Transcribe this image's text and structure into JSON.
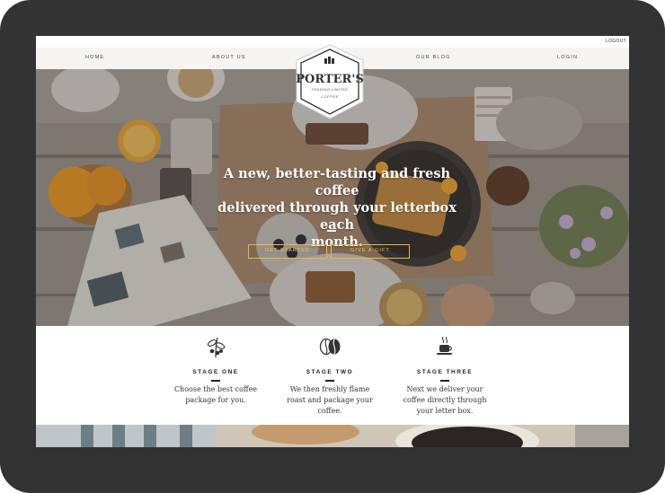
{
  "top": {
    "logout": "LOGOUT"
  },
  "nav": {
    "home": "HOME",
    "about": "ABOUT US",
    "blog": "OUR BLOG",
    "login": "LOGIN"
  },
  "logo": {
    "brand": "PORTER'S",
    "sub": "TRADING LIMITED",
    "coffee": "COFFEE"
  },
  "hero": {
    "title_line1": "A new, better-tasting and fresh coffee",
    "title_line2": "delivered through your letterbox each",
    "title_line3": "month.",
    "btn_start": "GET STARTED",
    "btn_gift": "GIVE A GIFT"
  },
  "stages": [
    {
      "icon": "coffee-plant-icon",
      "title": "STAGE ONE",
      "desc1": "Choose the best coffee",
      "desc2": "package for you.",
      "desc3": ""
    },
    {
      "icon": "coffee-bean-icon",
      "title": "STAGE TWO",
      "desc1": "We then freshly flame",
      "desc2": "roast and package your",
      "desc3": "coffee."
    },
    {
      "icon": "coffee-cup-icon",
      "title": "STAGE THREE",
      "desc1": "Next we deliver your",
      "desc2": "coffee directly through",
      "desc3": "your letter box."
    }
  ],
  "colors": {
    "frame": "#333333",
    "accent": "#e8b94a",
    "nav_bg": "#f4f3f0"
  }
}
